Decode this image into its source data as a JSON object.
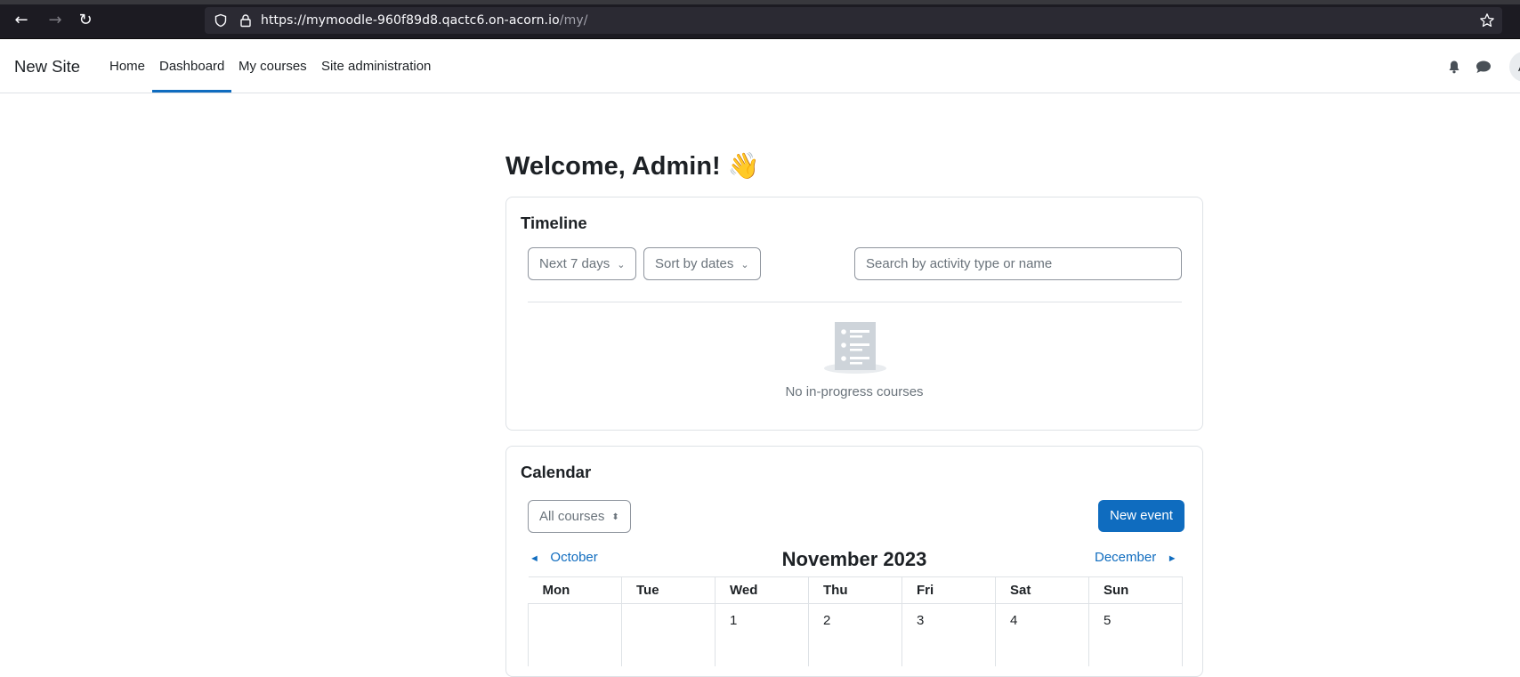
{
  "browser": {
    "url_host": "https://mymoodle-960f89d8.qactc6.on-acorn.io",
    "url_path": "/my/"
  },
  "navbar": {
    "brand": "New Site",
    "links": [
      {
        "label": "Home"
      },
      {
        "label": "Dashboard",
        "active": true
      },
      {
        "label": "My courses"
      },
      {
        "label": "Site administration"
      }
    ],
    "avatar_initial": "A"
  },
  "main": {
    "welcome": "Welcome, Admin! 👋"
  },
  "timeline": {
    "title": "Timeline",
    "range_select": "Next 7 days",
    "sort_select": "Sort by dates",
    "search_placeholder": "Search by activity type or name",
    "empty_text": "No in-progress courses"
  },
  "calendar": {
    "title": "Calendar",
    "course_select": "All courses",
    "new_event": "New event",
    "prev_month": "October",
    "next_month": "December",
    "month_title": "November 2023",
    "weekdays": [
      "Mon",
      "Tue",
      "Wed",
      "Thu",
      "Fri",
      "Sat",
      "Sun"
    ],
    "first_week": [
      "",
      "",
      "1",
      "2",
      "3",
      "4",
      "5"
    ]
  },
  "colors": {
    "accent": "#0f6cbf",
    "browser_bg": "#1c1b22"
  }
}
